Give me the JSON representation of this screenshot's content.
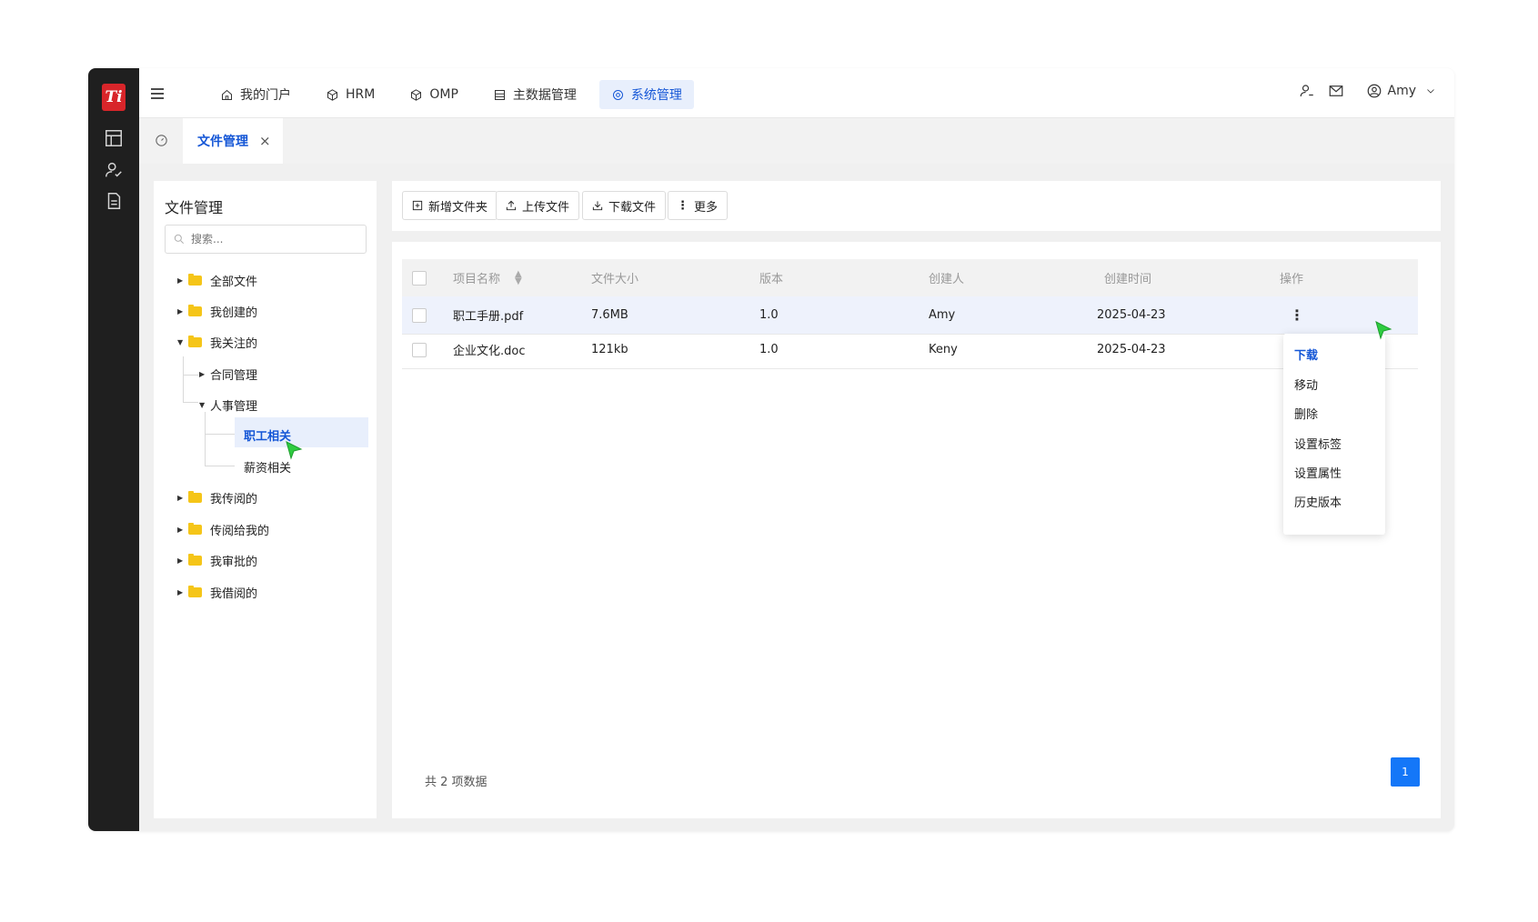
{
  "app": {
    "logo_text": "Ti",
    "brand_color": "#d8252a",
    "accent_color": "#1456d6"
  },
  "sidebar": {
    "icons": [
      "layout-icon",
      "user-check-icon",
      "document-icon"
    ]
  },
  "topnav": {
    "items": [
      {
        "label": "我的门户",
        "icon": "home-icon"
      },
      {
        "label": "HRM",
        "icon": "cube-icon"
      },
      {
        "label": "OMP",
        "icon": "cube-icon"
      },
      {
        "label": "主数据管理",
        "icon": "table-icon"
      },
      {
        "label": "系统管理",
        "icon": "gear-icon",
        "active": true
      }
    ],
    "user_name": "Amy"
  },
  "tabs": {
    "active_label": "文件管理",
    "close": "×"
  },
  "tree": {
    "title": "文件管理",
    "search_placeholder": "搜索...",
    "items": [
      {
        "label": "全部文件"
      },
      {
        "label": "我创建的"
      },
      {
        "label": "我关注的"
      },
      {
        "label": "合同管理"
      },
      {
        "label": "人事管理"
      },
      {
        "label": "职工相关",
        "selected": true
      },
      {
        "label": "薪资相关"
      },
      {
        "label": "我传阅的"
      },
      {
        "label": "传阅给我的"
      },
      {
        "label": "我审批的"
      },
      {
        "label": "我借阅的"
      }
    ]
  },
  "toolbar": {
    "new_folder": "新增文件夹",
    "upload": "上传文件",
    "download": "下载文件",
    "more": "更多"
  },
  "table": {
    "columns": [
      "项目名称",
      "文件大小",
      "版本",
      "创建人",
      "创建时间",
      "操作"
    ],
    "rows": [
      {
        "name": "职工手册.pdf",
        "size": "7.6MB",
        "version": "1.0",
        "creator": "Amy",
        "created": "2025-04-23"
      },
      {
        "name": "企业文化.doc",
        "size": "121kb",
        "version": "1.0",
        "creator": "Keny",
        "created": "2025-04-23"
      }
    ],
    "total": "共 2 项数据",
    "page": "1"
  },
  "context_menu": {
    "items": [
      "下载",
      "移动",
      "删除",
      "设置标签",
      "设置属性",
      "历史版本"
    ]
  }
}
